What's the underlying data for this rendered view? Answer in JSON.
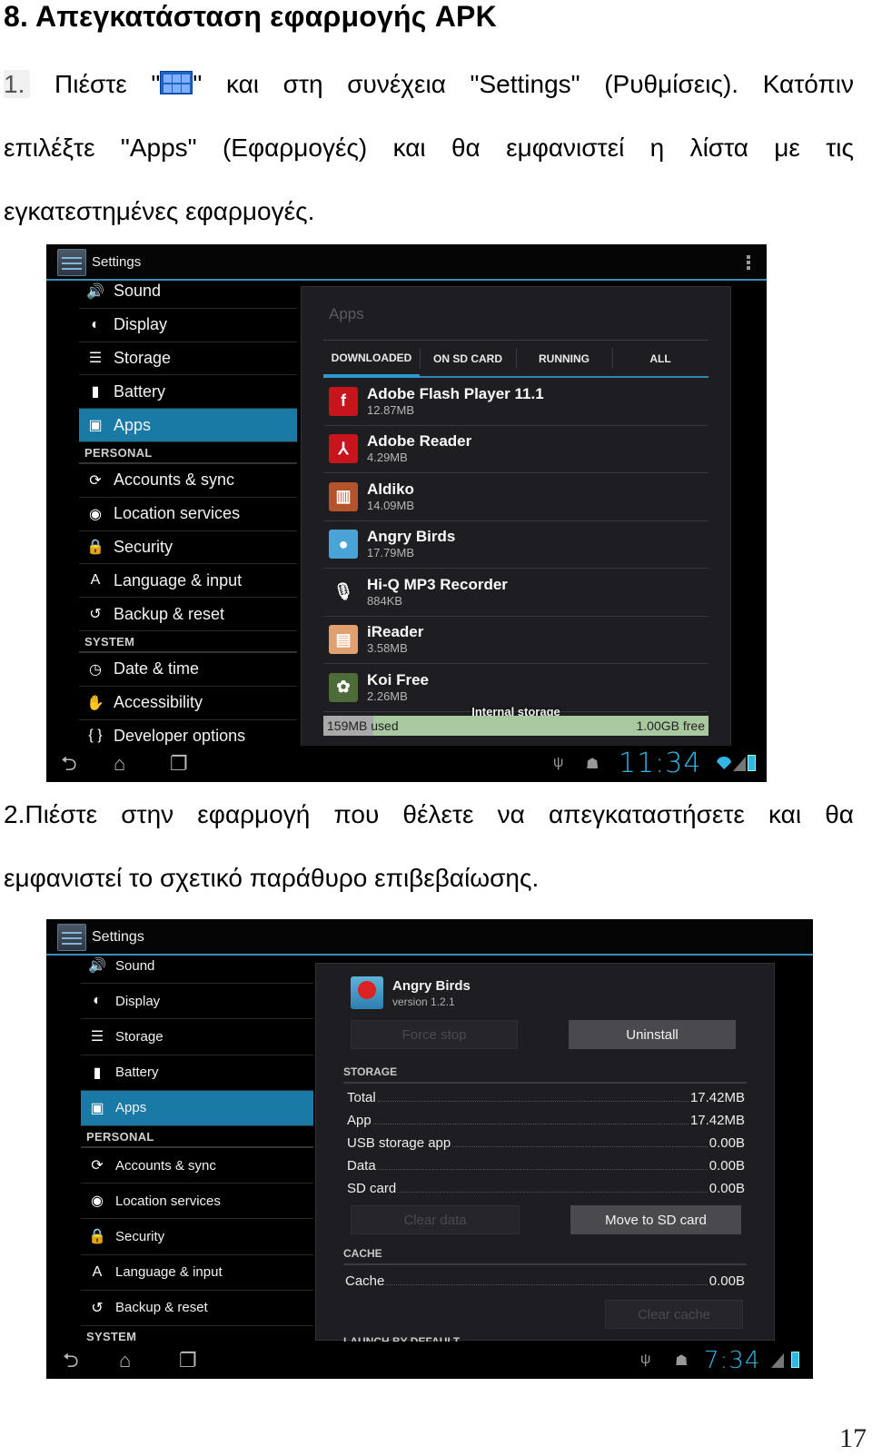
{
  "document": {
    "heading": "8.  Απεγκατάσταση εφαρμογής APK",
    "step1": {
      "number": "1.",
      "line1_part1": "Πιέστε \"",
      "launcher_icon": "apps-grid-icon",
      "line1_part2": "\" και στη συνέχεια \"Settings\" (Ρυθμίσεις). Κατόπιν",
      "line2": "επιλέξτε \"Apps\" (Εφαρμογές) και θα εμφανιστεί η λίστα με τις",
      "line3": "εγκατεστημένες εφαρμογές."
    },
    "step2": {
      "line1": "2.Πιέστε στην εφαρμογή που θέλετε να απεγκαταστήσετε και θα",
      "line2": "εμφανιστεί το σχετικό παράθυρο επιβεβαίωσης."
    },
    "page_number": "17"
  },
  "screenshot1": {
    "action_bar": {
      "title": "Settings",
      "app_icon": "settings-icon",
      "overflow_icon": "overflow-menu-icon"
    },
    "sidebar": [
      {
        "type": "item",
        "label": "Sound",
        "icon": "sound-icon",
        "glyph": "🔊"
      },
      {
        "type": "item",
        "label": "Display",
        "icon": "display-icon",
        "glyph": "◐"
      },
      {
        "type": "item",
        "label": "Storage",
        "icon": "storage-icon",
        "glyph": "☰"
      },
      {
        "type": "item",
        "label": "Battery",
        "icon": "battery-icon",
        "glyph": "▮"
      },
      {
        "type": "item",
        "label": "Apps",
        "icon": "apps-icon",
        "glyph": "▣",
        "active": true
      },
      {
        "type": "header",
        "label": "PERSONAL"
      },
      {
        "type": "item",
        "label": "Accounts & sync",
        "icon": "sync-icon",
        "glyph": "⟳"
      },
      {
        "type": "item",
        "label": "Location services",
        "icon": "location-icon",
        "glyph": "◉"
      },
      {
        "type": "item",
        "label": "Security",
        "icon": "lock-icon",
        "glyph": "🔒"
      },
      {
        "type": "item",
        "label": "Language & input",
        "icon": "language-icon",
        "glyph": "A"
      },
      {
        "type": "item",
        "label": "Backup & reset",
        "icon": "backup-icon",
        "glyph": "↺"
      },
      {
        "type": "header",
        "label": "SYSTEM"
      },
      {
        "type": "item",
        "label": "Date & time",
        "icon": "clock-icon",
        "glyph": "◷"
      },
      {
        "type": "item",
        "label": "Accessibility",
        "icon": "hand-icon",
        "glyph": "✋"
      },
      {
        "type": "item",
        "label": "Developer options",
        "icon": "braces-icon",
        "glyph": "{ }"
      }
    ],
    "panel": {
      "title": "Apps",
      "tabs": [
        {
          "label": "DOWNLOADED",
          "active": true
        },
        {
          "label": "ON SD CARD"
        },
        {
          "label": "RUNNING"
        },
        {
          "label": "ALL"
        }
      ],
      "apps": [
        {
          "name": "Adobe Flash Player 11.1",
          "size": "12.87MB",
          "icon": "flash-player-icon",
          "glyph": "f",
          "color": "#c8141c"
        },
        {
          "name": "Adobe Reader",
          "size": "4.29MB",
          "icon": "adobe-reader-icon",
          "glyph": "⅄",
          "color": "#c8141c"
        },
        {
          "name": "Aldiko",
          "size": "14.09MB",
          "icon": "aldiko-icon",
          "glyph": "▥",
          "color": "#b5532c"
        },
        {
          "name": "Angry Birds",
          "size": "17.79MB",
          "icon": "angry-birds-icon",
          "glyph": "●",
          "color": "#4aa3d6"
        },
        {
          "name": "Hi-Q MP3 Recorder",
          "size": "884KB",
          "icon": "microphone-icon",
          "glyph": "🎙",
          "color": "#1e1e22"
        },
        {
          "name": "iReader",
          "size": "3.58MB",
          "icon": "ireader-icon",
          "glyph": "▤",
          "color": "#e0a070"
        },
        {
          "name": "Koi Free",
          "size": "2.26MB",
          "icon": "koi-free-icon",
          "glyph": "✿",
          "color": "#4f6b3a"
        }
      ],
      "storage": {
        "label": "Internal storage",
        "used": "159MB used",
        "free": "1.00GB free",
        "used_fraction": 0.13
      }
    },
    "status_bar": {
      "nav": {
        "back": "back-icon",
        "home": "home-icon",
        "recents": "recents-icon"
      },
      "time": "11:34"
    }
  },
  "screenshot2": {
    "action_bar": {
      "title": "Settings"
    },
    "sidebar": [
      {
        "type": "item",
        "label": "Sound",
        "icon": "sound-icon",
        "glyph": "🔊"
      },
      {
        "type": "item",
        "label": "Display",
        "icon": "display-icon",
        "glyph": "◐"
      },
      {
        "type": "item",
        "label": "Storage",
        "icon": "storage-icon",
        "glyph": "☰"
      },
      {
        "type": "item",
        "label": "Battery",
        "icon": "battery-icon",
        "glyph": "▮"
      },
      {
        "type": "item",
        "label": "Apps",
        "icon": "apps-icon",
        "glyph": "▣",
        "active": true
      },
      {
        "type": "header",
        "label": "PERSONAL"
      },
      {
        "type": "item",
        "label": "Accounts & sync",
        "icon": "sync-icon",
        "glyph": "⟳"
      },
      {
        "type": "item",
        "label": "Location services",
        "icon": "location-icon",
        "glyph": "◉"
      },
      {
        "type": "item",
        "label": "Security",
        "icon": "lock-icon",
        "glyph": "🔒"
      },
      {
        "type": "item",
        "label": "Language & input",
        "icon": "language-icon",
        "glyph": "A"
      },
      {
        "type": "item",
        "label": "Backup & reset",
        "icon": "backup-icon",
        "glyph": "↺"
      },
      {
        "type": "header",
        "label": "SYSTEM"
      }
    ],
    "app_info": {
      "name": "Angry Birds",
      "version": "version 1.2.1",
      "force_stop": "Force stop",
      "uninstall": "Uninstall",
      "storage_header": "STORAGE",
      "storage_rows": [
        {
          "label": "Total",
          "value": "17.42MB"
        },
        {
          "label": "App",
          "value": "17.42MB"
        },
        {
          "label": "USB storage app",
          "value": "0.00B"
        },
        {
          "label": "Data",
          "value": "0.00B"
        },
        {
          "label": "SD card",
          "value": "0.00B"
        }
      ],
      "clear_data": "Clear data",
      "move_to_sd": "Move to SD card",
      "cache_header": "CACHE",
      "cache_row": {
        "label": "Cache",
        "value": "0.00B"
      },
      "clear_cache": "Clear cache",
      "launch_header": "LAUNCH BY DEFAULT"
    },
    "status_bar": {
      "time": "7:34"
    }
  }
}
